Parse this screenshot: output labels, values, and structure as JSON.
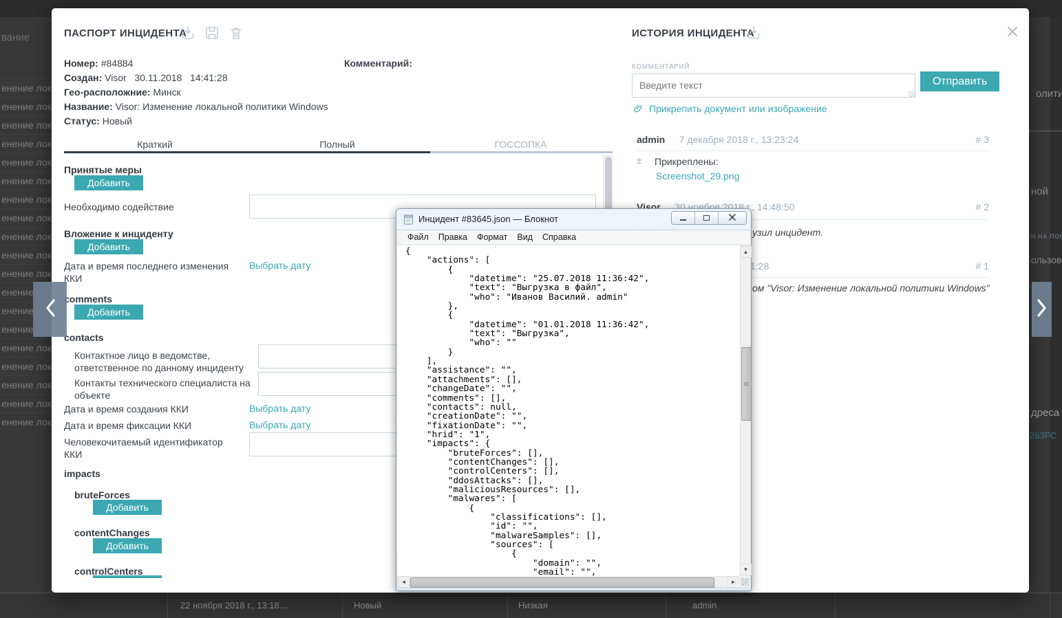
{
  "colors": {
    "accent_teal": "#3BA8B2",
    "link_teal": "#3AA7B5",
    "tab_underline_dark": "#323F4A",
    "tab_underline_light": "#B9C6D2",
    "muted_bluegray": "#9FB0BD",
    "overlay_bg": "#383838"
  },
  "background": {
    "top_fragment": "вание",
    "rows": [
      "енение лока...",
      "енение лока...",
      "енение лока...",
      "енение лока...",
      "енение лока...",
      "енение лока...",
      "енение лока...",
      "енение лока...",
      "енение лока...",
      "енение лока...",
      "енение лока...",
      "енение лока...",
      "енение лока...",
      "енение лока...",
      "енение лока...",
      "енение лока...",
      "енение лока...",
      "енение лока...",
      "енение лока..."
    ],
    "bottom_row": {
      "created": "22 ноября 2018 г., 13:18…",
      "status": "Новый",
      "severity": "Низкая",
      "user": "admin"
    },
    "right": {
      "f1": "олитик",
      "f2": "ной",
      "f3": "Н НА ПОЛЬ",
      "f4": "ользова",
      "f5": "дреса у",
      "f6": "263FC"
    }
  },
  "passport": {
    "title": "ПАСПОРТ ИНЦИДЕНТА",
    "fields": [
      {
        "label": "Номер:",
        "value": "#84884"
      },
      {
        "label": "Создан:",
        "value": "Visor   30.11.2018   14:41:28"
      },
      {
        "label": "Гео-расположние:",
        "value": "Минск"
      },
      {
        "label": "Название:",
        "value": "Visor: Изменение локальной политики Windows"
      },
      {
        "label": "Статус:",
        "value": "Новый"
      }
    ],
    "comment_label": "Комментарий:",
    "tabs": [
      {
        "label": "Краткий"
      },
      {
        "label": "Полный"
      },
      {
        "label": "ГОССОПКА",
        "active": true
      }
    ],
    "form": {
      "add_label": "Добавить",
      "pick_date_label": "Выбрать дату",
      "taken_measures": "Принятые меры",
      "assistance": "Необходимо содействие",
      "attachment": "Вложение к инциденту",
      "last_change": "Дата и время последнего изменения ККИ",
      "comments_key": "comments",
      "contacts_key": "contacts",
      "contact_person": "Контактное лицо в ведомстве, ответственное по данному инциденту",
      "tech_contact": "Контакты технического специалиста на объекте",
      "creation_date": "Дата и время создания ККИ",
      "fixation_date": "Дата и время фиксации ККИ",
      "hrid": "Человекочитаемый идентификатор ККИ",
      "impacts_key": "impacts",
      "bruteforces_key": "bruteForces",
      "contentchanges_key": "contentChanges",
      "controlcenters_key": "controlCenters"
    }
  },
  "history": {
    "title": "ИСТОРИЯ ИНЦИДЕНТА",
    "comment_label": "КОММЕНТАРИЙ",
    "comment_placeholder": "Введите текст",
    "send_label": "Отправить",
    "attach_label": "Прикрепить документ или изображение",
    "entries": {
      "e3": {
        "user": "admin",
        "date": "7 декабря 2018 г., 13:23:24",
        "num": "# 3",
        "attached_label": "Прикреплены:",
        "file": "Screenshot_29.png"
      },
      "e2": {
        "user": "Visor",
        "date": "30 ноября 2018 г., 14:48:50",
        "num": "# 2",
        "text_fragment": "узил инцидент."
      },
      "e1": {
        "date_fragment": "1:28",
        "num": "# 1",
        "text_fragment": "ом \"Visor: Изменение локальной политики Windows\""
      }
    }
  },
  "notepad": {
    "title": "Инцидент #83645.json — Блокнот",
    "menu": [
      "Файл",
      "Правка",
      "Формат",
      "Вид",
      "Справка"
    ],
    "content": "{\n    \"actions\": [\n        {\n            \"datetime\": \"25.07.2018 11:36:42\",\n            \"text\": \"Выгрузка в файл\",\n            \"who\": \"Иванов Василий. admin\"\n        },\n        {\n            \"datetime\": \"01.01.2018 11:36:42\",\n            \"text\": \"Выгрузка\",\n            \"who\": \"\"\n        }\n    ],\n    \"assistance\": \"\",\n    \"attachments\": [],\n    \"changeDate\": \"\",\n    \"comments\": [],\n    \"contacts\": null,\n    \"creationDate\": \"\",\n    \"fixationDate\": \"\",\n    \"hrid\": \"1\",\n    \"impacts\": {\n        \"bruteForces\": [],\n        \"contentChanges\": [],\n        \"controlCenters\": [],\n        \"ddosAttacks\": [],\n        \"maliciousResources\": [],\n        \"malwares\": [\n            {\n                \"classifications\": [],\n                \"id\": \"\",\n                \"malwareSamples\": [],\n                \"sources\": [\n                    {\n                        \"domain\": \"\",\n                        \"email\": \"\","
  }
}
